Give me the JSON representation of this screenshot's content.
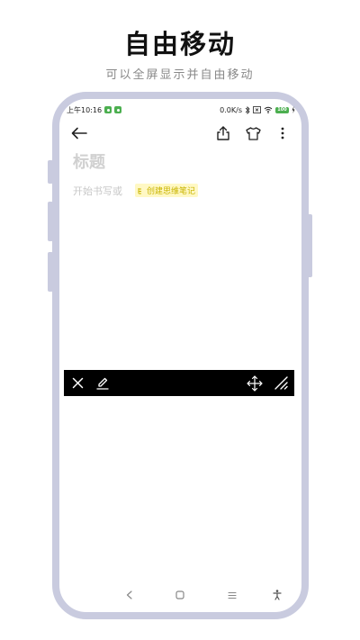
{
  "promo": {
    "title": "自由移动",
    "subtitle": "可以全屏显示并自由移动"
  },
  "status_bar": {
    "time": "上午10:16",
    "network_speed": "0.0K/s",
    "battery": "100",
    "icons": [
      "app-notification-icon",
      "app-notification-icon",
      "bluetooth-icon",
      "sim-icon",
      "wifi-icon",
      "battery-icon",
      "charging-icon"
    ]
  },
  "toolbar": {
    "icons": [
      "back-arrow-icon",
      "share-icon",
      "tshirt-theme-icon",
      "more-vertical-icon"
    ]
  },
  "note": {
    "title_placeholder": "标题",
    "body_placeholder": "开始书写或",
    "mindmap_link": "创建思维笔记"
  },
  "floating_bar": {
    "background": "#000000",
    "icons": [
      "close-icon",
      "pen-icon",
      "move-arrows-icon",
      "resize-icon"
    ]
  },
  "navigation": {
    "icons": [
      "nav-back-icon",
      "nav-home-icon",
      "nav-menu-icon",
      "accessibility-icon"
    ]
  },
  "colors": {
    "phone_frame": "#c9cbdf",
    "accent_yellow": "#c9b400",
    "status_green": "#4caf50"
  }
}
